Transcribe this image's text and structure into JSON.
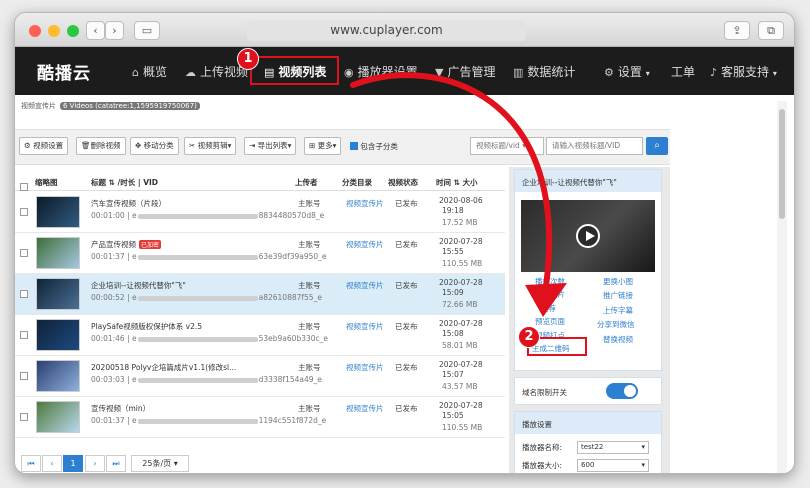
{
  "browser": {
    "url": "www.cuplayer.com",
    "back_icon": "chevron-left-icon",
    "forward_icon": "chevron-right-icon",
    "sidebar_icon": "sidebar-icon",
    "share_icon": "share-icon",
    "tabs_icon": "tabs-icon"
  },
  "nav": {
    "logo": "酷播云",
    "items": [
      {
        "label": "概览",
        "icon": "home-icon"
      },
      {
        "label": "上传视频",
        "icon": "cloud-upload-icon"
      },
      {
        "label": "视频列表",
        "icon": "film-icon"
      },
      {
        "label": "播放器设置",
        "icon": "play-circle-icon"
      },
      {
        "label": "广告管理",
        "icon": "filter-icon"
      },
      {
        "label": "数据统计",
        "icon": "bar-chart-icon"
      },
      {
        "label": "设置",
        "icon": "gear-icon"
      },
      {
        "label": "工单",
        "icon": ""
      },
      {
        "label": "客服支持",
        "icon": "bell-icon"
      }
    ]
  },
  "annotations": {
    "badge1": "1",
    "badge2": "2"
  },
  "breadcrumb": {
    "title": "视频宣传片",
    "tag": "6 Videos (catatree:1,1595919750067)"
  },
  "toolbar": {
    "video_settings": "视频设置",
    "delete_video": "删除视频",
    "move_category": "移动分类",
    "video_edit": "视频剪辑",
    "export_list": "导出列表",
    "more": "更多",
    "include_sub": "包含子分类",
    "search_scope": "视频标题/vid",
    "search_placeholder": "请输入视频标题/VID"
  },
  "table": {
    "headers": {
      "thumb": "缩略图",
      "title": "标题 ⇅ /时长 | VID",
      "uploader": "上传者",
      "category": "分类目录",
      "status": "视频状态",
      "time": "时间 ⇅ 大小"
    },
    "rows": [
      {
        "title": "汽车宣传视频（片段）",
        "duration": "00:01:00",
        "vid_prefix": "e",
        "vid_suffix": "8834480570d8_e",
        "uploader": "主账号",
        "category": "视频宣传片",
        "status": "已发布",
        "date": "2020-08-06",
        "time": "19:18",
        "size": "17.52 MB",
        "tag": ""
      },
      {
        "title": "产品宣传视频",
        "duration": "00:01:37",
        "vid_prefix": "e",
        "vid_suffix": "63e39df39a950_e",
        "uploader": "主账号",
        "category": "视频宣传片",
        "status": "已发布",
        "date": "2020-07-28",
        "time": "15:55",
        "size": "110.55 MB",
        "tag": "已加密"
      },
      {
        "title": "企业培训--让视频代替你\"飞\"",
        "duration": "00:00:52",
        "vid_prefix": "e",
        "vid_suffix": "a82610887f55_e",
        "uploader": "主账号",
        "category": "视频宣传片",
        "status": "已发布",
        "date": "2020-07-28",
        "time": "15:09",
        "size": "72.66 MB",
        "tag": ""
      },
      {
        "title": "PlaySafe视频版权保护体系 v2.5",
        "duration": "00:01:46",
        "vid_prefix": "e",
        "vid_suffix": "53eb9a60b330c_e",
        "uploader": "主账号",
        "category": "视频宣传片",
        "status": "已发布",
        "date": "2020-07-28",
        "time": "15:08",
        "size": "58.01 MB",
        "tag": ""
      },
      {
        "title": "20200518 Polyv企培篇成片v1.1(修改sl...",
        "duration": "00:03:03",
        "vid_prefix": "e",
        "vid_suffix": "d3338f154a49_e",
        "uploader": "主账号",
        "category": "视频宣传片",
        "status": "已发布",
        "date": "2020-07-28",
        "time": "15:07",
        "size": "43.57 MB",
        "tag": ""
      },
      {
        "title": "宣传视频（min）",
        "duration": "00:01:37",
        "vid_prefix": "e",
        "vid_suffix": "1194c551f872d_e",
        "uploader": "主账号",
        "category": "视频宣传片",
        "status": "已发布",
        "date": "2020-07-28",
        "time": "15:05",
        "size": "110.55 MB",
        "tag": ""
      }
    ]
  },
  "pager": {
    "current": "1",
    "page_size": "25条/页"
  },
  "side": {
    "video_title": "企业培训--让视频代替你\"飞\"",
    "links_left": [
      "播放次数",
      "下载图片",
      "推荐",
      "预览页面",
      "视频打点",
      "生成二维码"
    ],
    "links_right": [
      "更换小图",
      "推广链接",
      "上传字幕",
      "分享到微信",
      "替换视频"
    ],
    "domain_limit": "域名限制开关",
    "player_settings": "播放设置",
    "player_name_label": "播放器名称:",
    "player_name_value": "test22",
    "player_size_label": "播放器大小:",
    "player_size_value": "600"
  }
}
